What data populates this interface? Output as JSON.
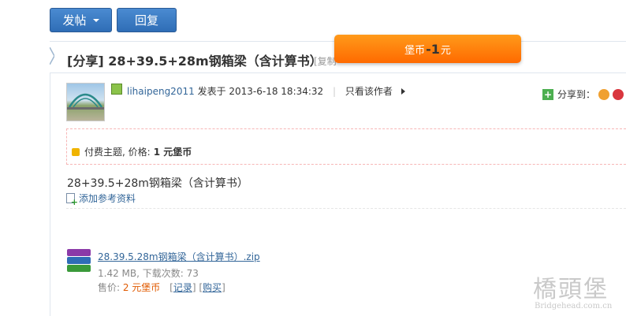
{
  "toolbar": {
    "post_label": "发帖",
    "reply_label": "回复"
  },
  "thread": {
    "title": "[分享] 28+39.5+28m钢箱梁（含计算书）",
    "copy_link": "[复制",
    "promo": {
      "prefix": "堡币",
      "value": "-1",
      "suffix": "元"
    }
  },
  "post": {
    "username": "lihaipeng2011",
    "posted_at": "发表于 2013-6-18 18:34:32",
    "author_only": "只看该作者",
    "share_label": "分享到：",
    "paid_notice": {
      "prefix": "付费主题, 价格:",
      "price": "1 元堡币"
    },
    "body": "28+39.5+28m钢箱梁（含计算书）",
    "add_reference": "添加参考资料"
  },
  "attachment": {
    "filename": "28.39.5.28m钢箱梁（含计算书）.zip",
    "meta": "1.42 MB, 下载次数: 73",
    "price_label": "售价: ",
    "price_value": "2 元堡币",
    "record_label": "记录",
    "buy_label": "购买"
  },
  "watermark": {
    "cn": "橋頭堡",
    "en": "Bridgehead.com.cn"
  },
  "colors": {
    "button_blue": "#2f6db6",
    "promo_orange": "#ff7a00",
    "link_blue": "#336699",
    "price_orange": "#e05a00"
  }
}
